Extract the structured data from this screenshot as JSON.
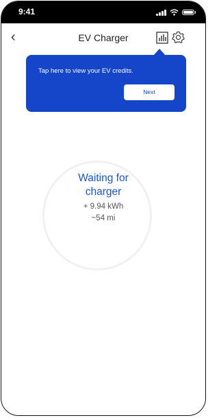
{
  "status_bar": {
    "time": "9:41"
  },
  "nav": {
    "title": "EV Charger"
  },
  "tooltip": {
    "message": "Tap here to view your EV credits.",
    "next_label": "Next"
  },
  "charger": {
    "status_line1": "Waiting for",
    "status_line2": "charger",
    "energy": "+ 9.94 kWh",
    "range": "~54 mi"
  },
  "colors": {
    "accent": "#1546c9",
    "status_text": "#1a55d8"
  }
}
